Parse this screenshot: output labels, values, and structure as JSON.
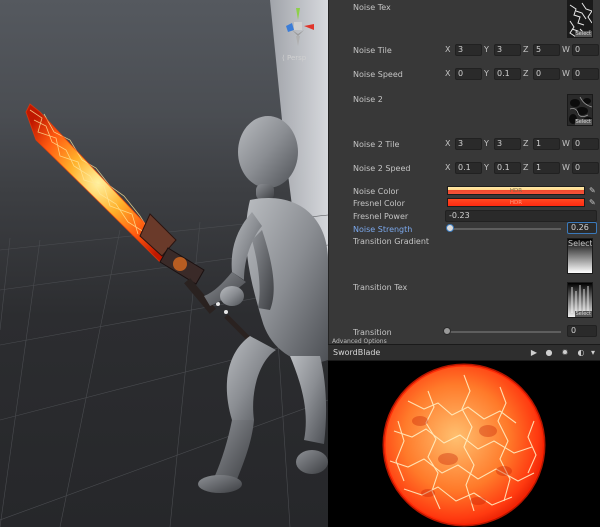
{
  "scene": {
    "view_mode": "Persp",
    "gizmo_axes": [
      "y",
      "x",
      "z"
    ]
  },
  "inspector": {
    "advanced_label": "Advanced Options",
    "properties": {
      "noise_tex": {
        "label": "Noise Tex",
        "select": "Select"
      },
      "noise_tile": {
        "label": "Noise Tile",
        "x": "3",
        "y": "3",
        "z": "5",
        "w": "0"
      },
      "noise_speed": {
        "label": "Noise Speed",
        "x": "0",
        "y": "0.1",
        "z": "0",
        "w": "0"
      },
      "noise_2": {
        "label": "Noise 2",
        "select": "Select"
      },
      "noise_2_tile": {
        "label": "Noise 2 Tile",
        "x": "3",
        "y": "3",
        "z": "1",
        "w": "0"
      },
      "noise_2_speed": {
        "label": "Noise 2 Speed",
        "x": "0.1",
        "y": "0.1",
        "z": "1",
        "w": "0"
      },
      "noise_color": {
        "label": "Noise Color",
        "hdr": "HDR",
        "color": "#f5533a"
      },
      "fresnel_color": {
        "label": "Fresnel Color",
        "hdr": "HDR",
        "color": "#ff2a10"
      },
      "fresnel_power": {
        "label": "Fresnel Power",
        "value": "-0.23"
      },
      "noise_strength": {
        "label": "Noise Strength",
        "value": "0.26",
        "level": 0.03
      },
      "transition_gradient": {
        "label": "Transition Gradient",
        "select": "Select"
      },
      "transition_tex": {
        "label": "Transition Tex",
        "select": "Select"
      },
      "transition": {
        "label": "Transition",
        "value": "0",
        "level": 0.0
      }
    },
    "axis_labels": {
      "x": "X",
      "y": "Y",
      "z": "Z",
      "w": "W"
    }
  },
  "preview": {
    "title": "SwordBlade",
    "icons": [
      "play-icon",
      "sphere-mesh-icon",
      "light-icon",
      "material-preview-icon",
      "dropdown-icon"
    ]
  },
  "colors": {
    "panel_bg": "#383838",
    "field_bg": "#2a2a2a",
    "accent_blue": "#7ba8ec",
    "lava_orange": "#ff6a1a"
  }
}
